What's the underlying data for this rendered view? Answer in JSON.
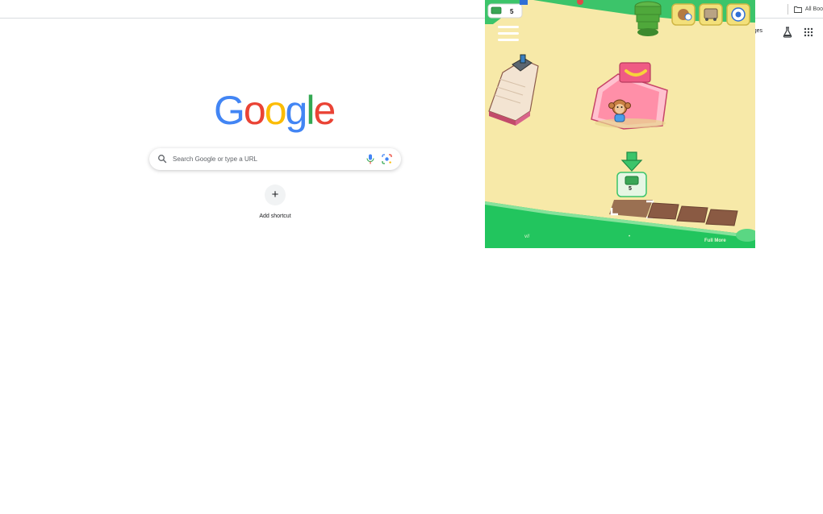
{
  "bookmarks_bar": {
    "all_bookmarks_label": "All Boo"
  },
  "header": {
    "images_label": "mages"
  },
  "logo": {
    "letters": [
      "G",
      "o",
      "o",
      "g",
      "l",
      "e"
    ],
    "colors": [
      "#4285F4",
      "#EA4335",
      "#FBBC05",
      "#4285F4",
      "#34A853",
      "#EA4335"
    ]
  },
  "search": {
    "placeholder": "Search Google or type a URL",
    "value": ""
  },
  "shortcuts": {
    "add_symbol": "+",
    "add_label": "Add shortcut"
  },
  "game": {
    "cash_amount": "5",
    "bill_price": "5",
    "footer_left": "v//",
    "footer_dot": "•",
    "footer_right": "Full   More"
  },
  "icons": {
    "folder": "folder-icon",
    "labs": "labs-flask-icon",
    "apps": "apps-grid-icon",
    "search": "search-icon",
    "mic": "mic-icon",
    "lens": "lens-icon",
    "menu": "hamburger-menu-icon"
  },
  "colors": {
    "grass": "#22c55e",
    "sand": "#f7e9a8",
    "accent_pink": "#f06b8a"
  }
}
